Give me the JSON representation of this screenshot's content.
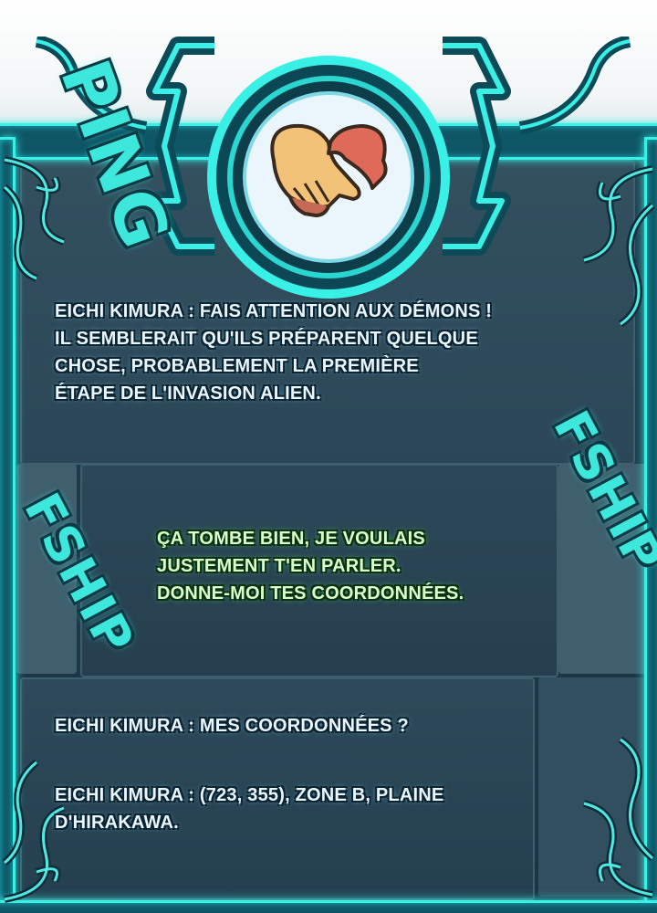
{
  "sfx": {
    "ping": "PING",
    "fship_right": "FSHIP",
    "fship_left": "FSHIP"
  },
  "emblem": {
    "icon": "handshake-heart-icon"
  },
  "dialogues": [
    {
      "lines": [
        "EICHI KIMURA : FAIS ATTENTION AUX DÉMONS !",
        "IL SEMBLERAIT QU'ILS PRÉPARENT QUELQUE",
        "CHOSE, PROBABLEMENT LA PREMIÈRE",
        "ÉTAPE DE L'INVASION ALIEN."
      ]
    },
    {
      "lines": [
        "ÇA TOMBE BIEN, JE VOULAIS",
        "JUSTEMENT T'EN PARLER.",
        "DONNE-MOI TES COORDONNÉES."
      ]
    },
    {
      "lines": [
        "EICHI KIMURA : MES COORDONNÉES ?"
      ]
    },
    {
      "lines": [
        "EICHI KIMURA : (723, 355), ZONE B, PLAINE",
        "D'HIRAKAWA."
      ]
    }
  ],
  "colors": {
    "frame_glow": "#39f0e6",
    "panel": "#2b4757",
    "player_text": "#d9ffc8",
    "system_text": "#e9f6ff"
  }
}
